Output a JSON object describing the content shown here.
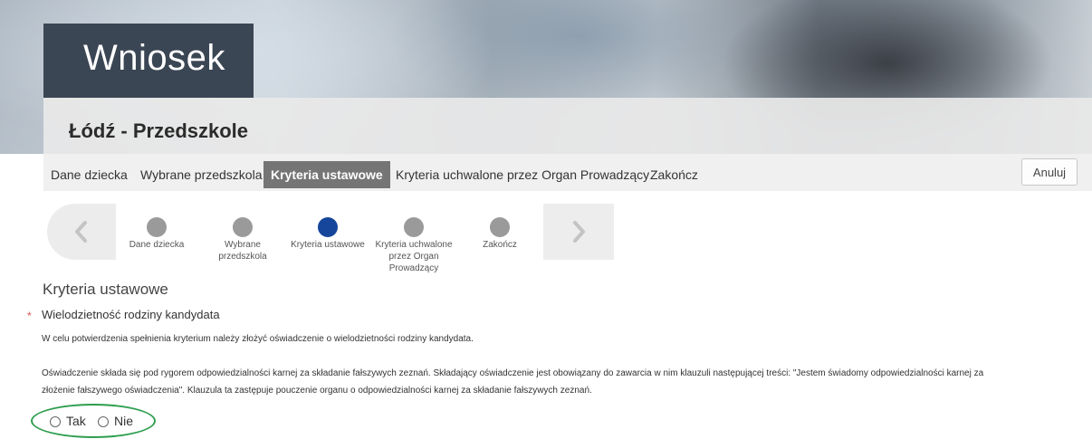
{
  "header": {
    "title": "Wniosek",
    "subtitle": "Łódź - Przedszkole"
  },
  "tabs": [
    {
      "label": "Dane dziecka",
      "active": false
    },
    {
      "label": "Wybrane przedszkola",
      "active": false
    },
    {
      "label": "Kryteria ustawowe",
      "active": true
    },
    {
      "label": "Kryteria uchwalone przez Organ Prowadzący",
      "active": false
    },
    {
      "label": "Zakończ",
      "active": false
    }
  ],
  "cancel_label": "Anuluj",
  "steps": [
    {
      "label": "Dane dziecka",
      "state": "inactive"
    },
    {
      "label": "Wybrane przedszkola",
      "state": "inactive"
    },
    {
      "label": "Kryteria ustawowe",
      "state": "current"
    },
    {
      "label": "Kryteria uchwalone przez Organ Prowadzący",
      "state": "inactive"
    },
    {
      "label": "Zakończ",
      "state": "inactive"
    }
  ],
  "icons": {
    "prev": "chevron-left-icon",
    "next": "chevron-right-icon"
  },
  "section_title": "Kryteria ustawowe",
  "criterion": {
    "required_marker": "*",
    "label": "Wielodzietność rodziny kandydata",
    "description1": "W celu potwierdzenia spełnienia kryterium należy złożyć oświadczenie o wielodzietności rodziny kandydata.",
    "description2a": "Oświadczenie składa się pod rygorem odpowiedzialności karnej za składanie fałszywych zeznań. Składający oświadczenie jest obowiązany do zawarcia w nim klauzuli następującej treści: \"Jestem świadomy odpowiedzialności karnej za",
    "description2b": "złożenie fałszywego oświadczenia\". Klauzula ta zastępuje pouczenie organu o odpowiedzialności karnej za składanie fałszywych zeznań.",
    "options": [
      {
        "label": "Tak",
        "checked": false
      },
      {
        "label": "Nie",
        "checked": false
      }
    ]
  },
  "colors": {
    "active_step": "#16469b",
    "inactive_step": "#9a9a9a",
    "active_tab": "#757575",
    "highlight_ellipse": "#2e9e4e",
    "required": "#d9534f"
  }
}
